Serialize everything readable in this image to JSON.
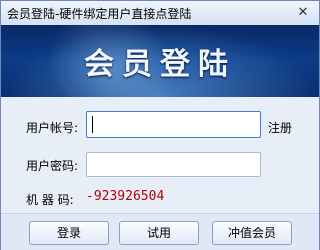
{
  "window": {
    "title": "会员登陆-硬件绑定用户直接点登陆",
    "close_glyph": "✕"
  },
  "banner": {
    "title": "会员登陆"
  },
  "form": {
    "account_label": "用户帐号:",
    "account_value": "",
    "register_link": "注册",
    "password_label": "用户密码:",
    "password_value": "",
    "machine_label": "机 器 码:",
    "machine_code": "-923926504"
  },
  "buttons": {
    "login": "登录",
    "trial": "试用",
    "recharge": "冲值会员"
  },
  "colors": {
    "banner": "#0c3c88",
    "machine_code": "#b50000",
    "focus_border": "#3d7bd6"
  }
}
